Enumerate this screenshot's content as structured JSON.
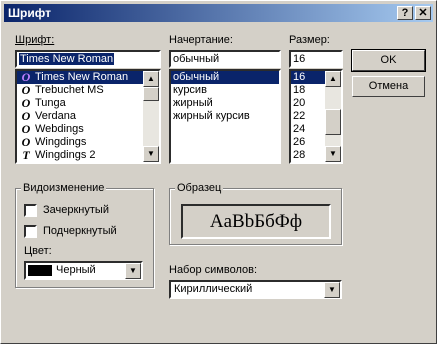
{
  "window": {
    "title": "Шрифт",
    "help_label": "?",
    "close_label": "✕"
  },
  "font": {
    "label": "Шрифт:",
    "value": "Times New Roman",
    "items": [
      "Times New Roman",
      "Trebuchet MS",
      "Tunga",
      "Verdana",
      "Webdings",
      "Wingdings",
      "Wingdings 2"
    ],
    "icons": [
      "O",
      "O",
      "O",
      "O",
      "O",
      "O",
      "T"
    ],
    "selected": "Times New Roman"
  },
  "style": {
    "label": "Начертание:",
    "value": "обычный",
    "items": [
      "обычный",
      "курсив",
      "жирный",
      "жирный курсив"
    ],
    "selected": "обычный"
  },
  "size": {
    "label": "Размер:",
    "value": "16",
    "items": [
      "16",
      "18",
      "20",
      "22",
      "24",
      "26",
      "28"
    ],
    "selected": "16"
  },
  "buttons": {
    "ok": "OK",
    "cancel": "Отмена"
  },
  "effects": {
    "title": "Видоизменение",
    "strikeout": "Зачеркнутый",
    "underline": "Подчеркнутый",
    "color_label": "Цвет:",
    "color_value": "Черный",
    "color_swatch": "#000000"
  },
  "sample": {
    "title": "Образец",
    "text": "AaBbБбФф"
  },
  "charset": {
    "label": "Набор символов:",
    "value": "Кириллический"
  },
  "colors": {
    "titlebar_start": "#0a246a",
    "titlebar_end": "#a6caf0",
    "selection": "#0a246a",
    "face": "#d4d0c8"
  }
}
